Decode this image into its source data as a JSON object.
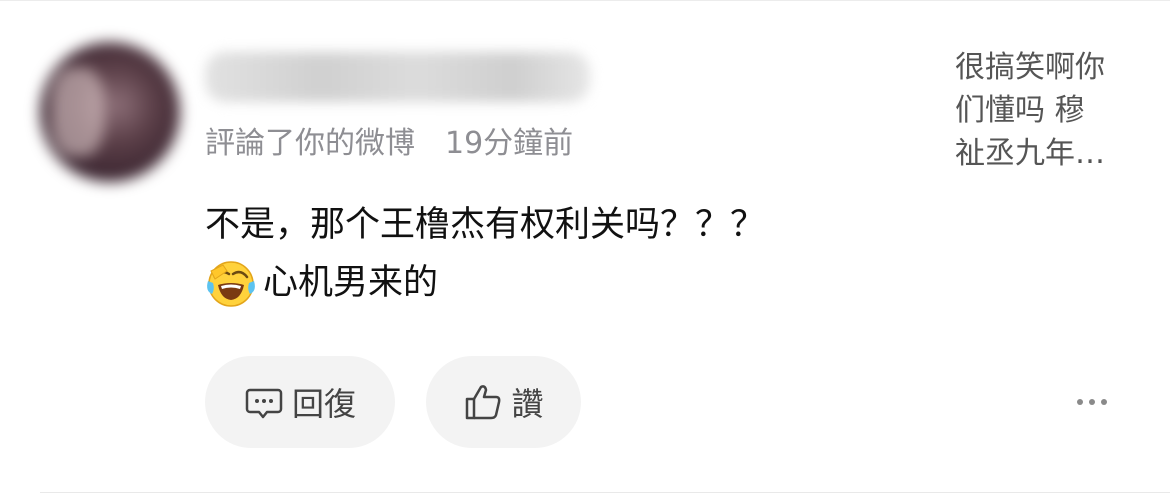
{
  "notification": {
    "meta": {
      "action": "評論了你的微博",
      "time": "19分鐘前"
    },
    "comment": {
      "line1": "不是，那个王橹杰有权利关吗？？？",
      "line2": "心机男来的",
      "emoji": "laughing-crying-face-icon"
    },
    "original_post_preview": {
      "line1": "很搞笑啊你",
      "line2": "们懂吗  穆",
      "line3": "祉丞九年…"
    },
    "actions": {
      "reply_label": "回復",
      "like_label": "讚",
      "reply_icon": "comment-bubble-icon",
      "like_icon": "thumbs-up-icon",
      "more_icon": "more-dots-icon"
    }
  },
  "colors": {
    "meta_text": "#8e8e93",
    "comment_text": "#111111",
    "button_bg": "#f3f3f3",
    "preview_text": "#555555"
  }
}
